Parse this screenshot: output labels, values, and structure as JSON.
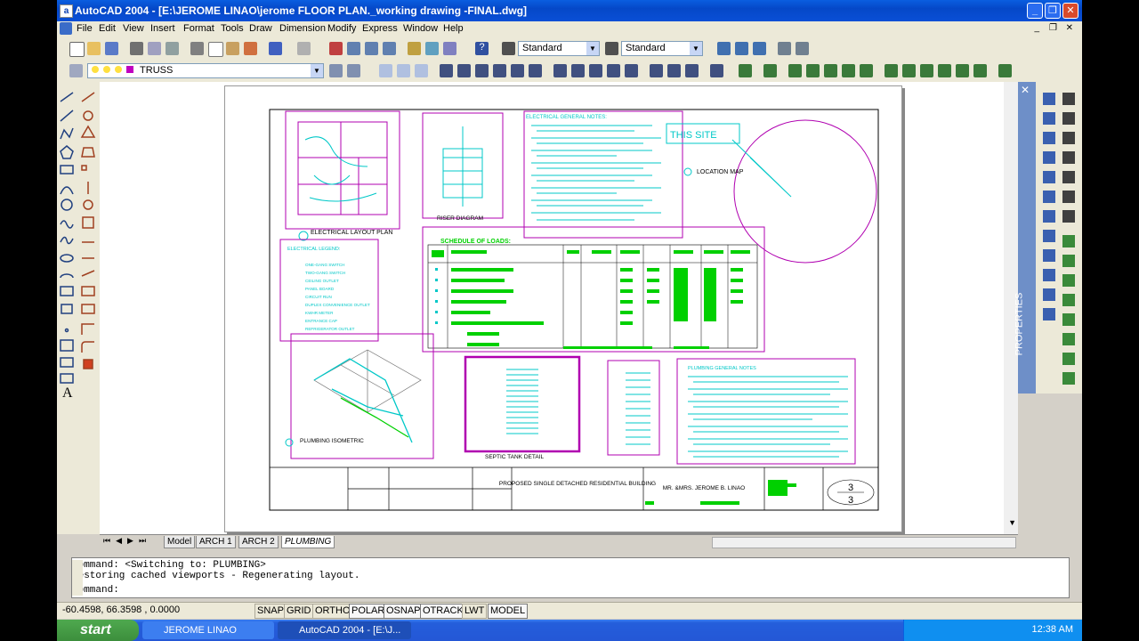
{
  "window": {
    "title": "AutoCAD 2004 - [E:\\JEROME LINAO\\jerome FLOOR PLAN._working drawing -FINAL.dwg]"
  },
  "menu": [
    "File",
    "Edit",
    "View",
    "Insert",
    "Format",
    "Tools",
    "Draw",
    "Dimension",
    "Modify",
    "Express",
    "Window",
    "Help"
  ],
  "toolbar": {
    "text_style": "Standard",
    "dim_style": "Standard",
    "layer": "TRUSS"
  },
  "drawing": {
    "labels": {
      "electrical_layout_plan": "ELECTRICAL LAYOUT PLAN",
      "riser_diagram": "RISER DIAGRAM",
      "location_map": "LOCATION MAP",
      "this_site": "THIS SITE",
      "electrical_general_notes": "ELECTRICAL GENERAL NOTES:",
      "schedule_of_loads": "SCHEDULE OF LOADS:",
      "electrical_legend": "ELECTRICAL LEGEND:",
      "plumbing_isometric": "PLUMBING ISOMETRIC",
      "septic_tank_detail": "SEPTIC TANK DETAIL",
      "plumbing_general_notes": "PLUMBING GENERAL NOTES"
    },
    "legend_items": [
      "ONE-GANG SWITCH",
      "TWO-GANG SWITCH",
      "CEILING OUTLET",
      "PANEL BOARD",
      "CIRCUIT RUN",
      "DUPLEX CONVENIENCE OUTLET",
      "KWHR METER",
      "ENTRANCE CAP",
      "REFRIGERATOR OUTLET"
    ],
    "title_block": {
      "project": "PROPOSED SINGLE DETACHED RESIDENTIAL BUILDING",
      "owner": "MR. &MRS. JEROME B. LINAO",
      "sheet_number": "3",
      "sheet_total": "3"
    }
  },
  "layout_tabs": [
    "Model",
    "ARCH 1",
    "ARCH 2",
    "PLUMBING"
  ],
  "command": {
    "lines": [
      "Command:  <Switching to: PLUMBING>",
      "Restoring cached viewports - Regenerating layout."
    ],
    "prompt": "Command:"
  },
  "status": {
    "coords": "-60.4598, 66.3598 , 0.0000",
    "toggles": [
      "SNAP",
      "GRID",
      "ORTHO",
      "POLAR",
      "OSNAP",
      "OTRACK",
      "LWT",
      "MODEL"
    ]
  },
  "properties_palette": {
    "label": "PROPERTIES"
  },
  "taskbar": {
    "start": "start",
    "tasks": [
      "JEROME LINAO",
      "AutoCAD 2004 - [E:\\J..."
    ],
    "clock": "12:38 AM"
  },
  "colors": {
    "magenta": "#b000b0",
    "cyan": "#00c8c8",
    "green": "#00d000"
  }
}
